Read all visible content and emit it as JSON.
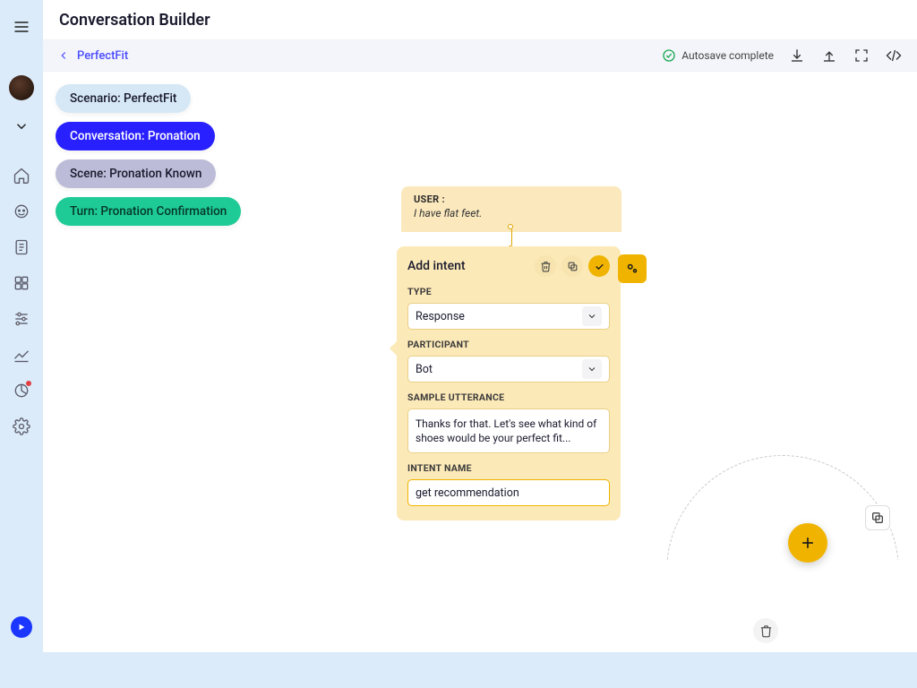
{
  "app": {
    "title": "Conversation Builder"
  },
  "breadcrumb": {
    "item": "PerfectFit"
  },
  "autosave": {
    "label": "Autosave complete"
  },
  "pills": {
    "scenario": "Scenario: PerfectFit",
    "conversation": "Conversation: Pronation",
    "scene": "Scene: Pronation Known",
    "turn": "Turn: Pronation Confirmation"
  },
  "user_node": {
    "label": "USER :",
    "text": "I have flat feet."
  },
  "intent": {
    "title": "Add intent",
    "type_label": "TYPE",
    "type_value": "Response",
    "participant_label": "PARTICIPANT",
    "participant_value": "Bot",
    "sample_label": "SAMPLE UTTERANCE",
    "sample_value": "Thanks for that. Let's see what kind of shoes would be your perfect fit...",
    "name_label": "INTENT NAME",
    "name_value": "get recommendation"
  },
  "icons": {
    "menu": "menu",
    "avatar": "avatar",
    "expand": "expand",
    "home": "home",
    "bot": "bot",
    "doc": "doc",
    "grid": "grid",
    "sliders": "sliders",
    "analytics": "analytics",
    "pie": "pie",
    "gear": "gear",
    "download": "download",
    "upload": "upload",
    "fullscreen": "fullscreen",
    "code": "code",
    "trash": "trash",
    "copy": "copy",
    "check": "check",
    "cogs": "cogs",
    "plus": "plus",
    "play": "play"
  }
}
